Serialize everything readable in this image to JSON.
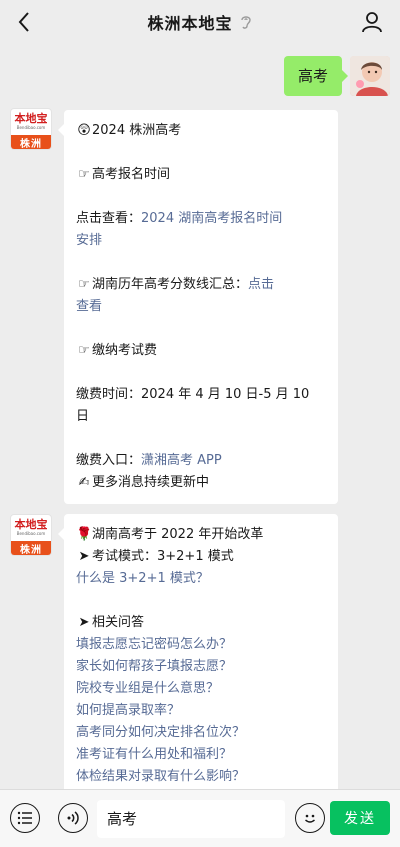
{
  "header": {
    "title": "株洲本地宝"
  },
  "user_message": {
    "text": "高考"
  },
  "bot": {
    "avatar_brand": "本地宝",
    "avatar_domain": "Bendibao.com",
    "avatar_city": "株洲"
  },
  "message1": {
    "title": "2024 株洲高考",
    "item1": "高考报名时间",
    "click_prefix": "点击查看：",
    "reg_link_l1": "2024 湖南高考报名时间",
    "reg_link_l2": "安排",
    "item2_prefix": "湖南历年高考分数线汇总：",
    "item2_link_l1": "点击",
    "item2_link_l2": "查看",
    "item3": "缴纳考试费",
    "fee_time_l1": "缴费时间：2024 年 4 月 10 日-5 月 10",
    "fee_time_l2": "日",
    "fee_entry_prefix": "缴费入口：",
    "fee_entry_link": "潇湘高考 APP",
    "more": "更多消息持续更新中"
  },
  "message2": {
    "title": "湖南高考于 2022 年开始改革",
    "mode_label": "考试模式：3+2+1 模式",
    "mode_link": "什么是 3+2+1 模式？",
    "faq_heading": "相关问答",
    "faqs": [
      "填报志愿忘记密码怎么办？",
      "家长如何帮孩子填报志愿？",
      "院校专业组是什么意思？",
      "如何提高录取率？",
      "高考同分如何决定排名位次？",
      "准考证有什么用处和福利？",
      "体检结果对录取有什么影响？"
    ]
  },
  "bottom_bar": {
    "input_value": "高考",
    "send_label": "发送"
  },
  "icons": {
    "back": "chevron-left-icon",
    "ear": "ear-icon",
    "profile": "person-icon",
    "menu": "list-icon",
    "voice": "voice-icon",
    "emoji": "smiley-icon"
  },
  "colors": {
    "background": "#ededed",
    "user_bubble": "#95ec69",
    "link": "#576b95",
    "send_button": "#07c160",
    "avatar_city_bar": "#e8501a"
  }
}
